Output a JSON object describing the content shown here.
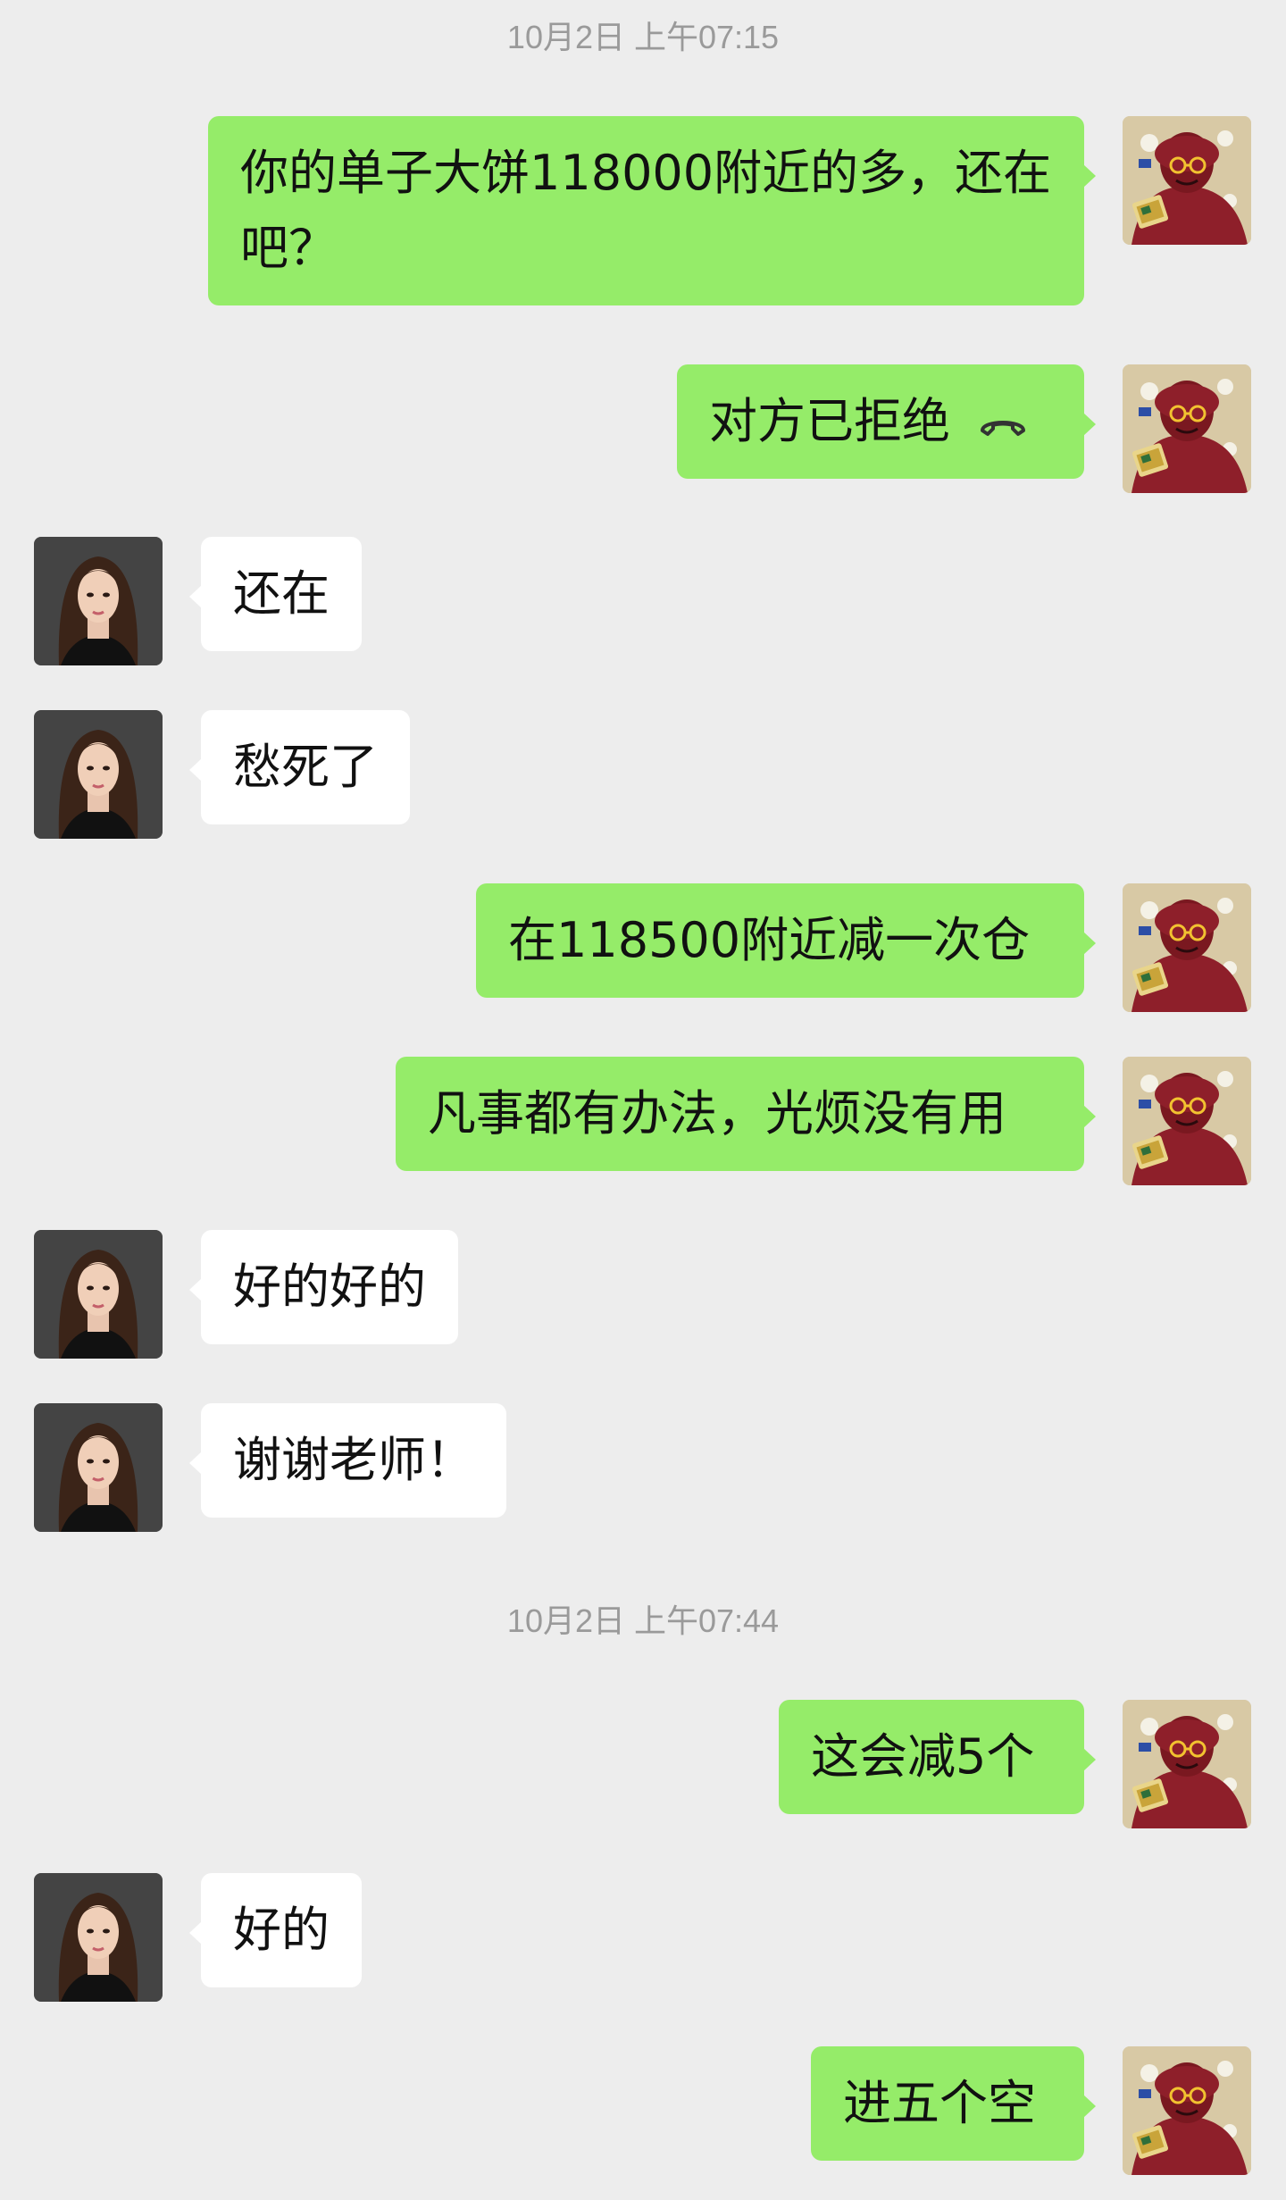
{
  "timestamps": [
    "10月2日 上午07:15",
    "10月2日 上午07:44"
  ],
  "messages": [
    {
      "sender": "me",
      "text": "你的单子大饼118000附近的多，还在吧？"
    },
    {
      "sender": "me",
      "text": "对方已拒绝",
      "icon": "phone-hangup-icon"
    },
    {
      "sender": "them",
      "text": "还在"
    },
    {
      "sender": "them",
      "text": "愁死了"
    },
    {
      "sender": "me",
      "text": "在118500附近减一次仓"
    },
    {
      "sender": "me",
      "text": "凡事都有办法，光烦没有用"
    },
    {
      "sender": "them",
      "text": "好的好的"
    },
    {
      "sender": "them",
      "text": "谢谢老师！"
    },
    {
      "sender": "me",
      "text": "这会减5个"
    },
    {
      "sender": "them",
      "text": "好的"
    },
    {
      "sender": "me",
      "text": "进五个空"
    }
  ],
  "colors": {
    "background": "#ededed",
    "my_bubble": "#95ec69",
    "their_bubble": "#ffffff",
    "timestamp": "#9a9a9a"
  }
}
